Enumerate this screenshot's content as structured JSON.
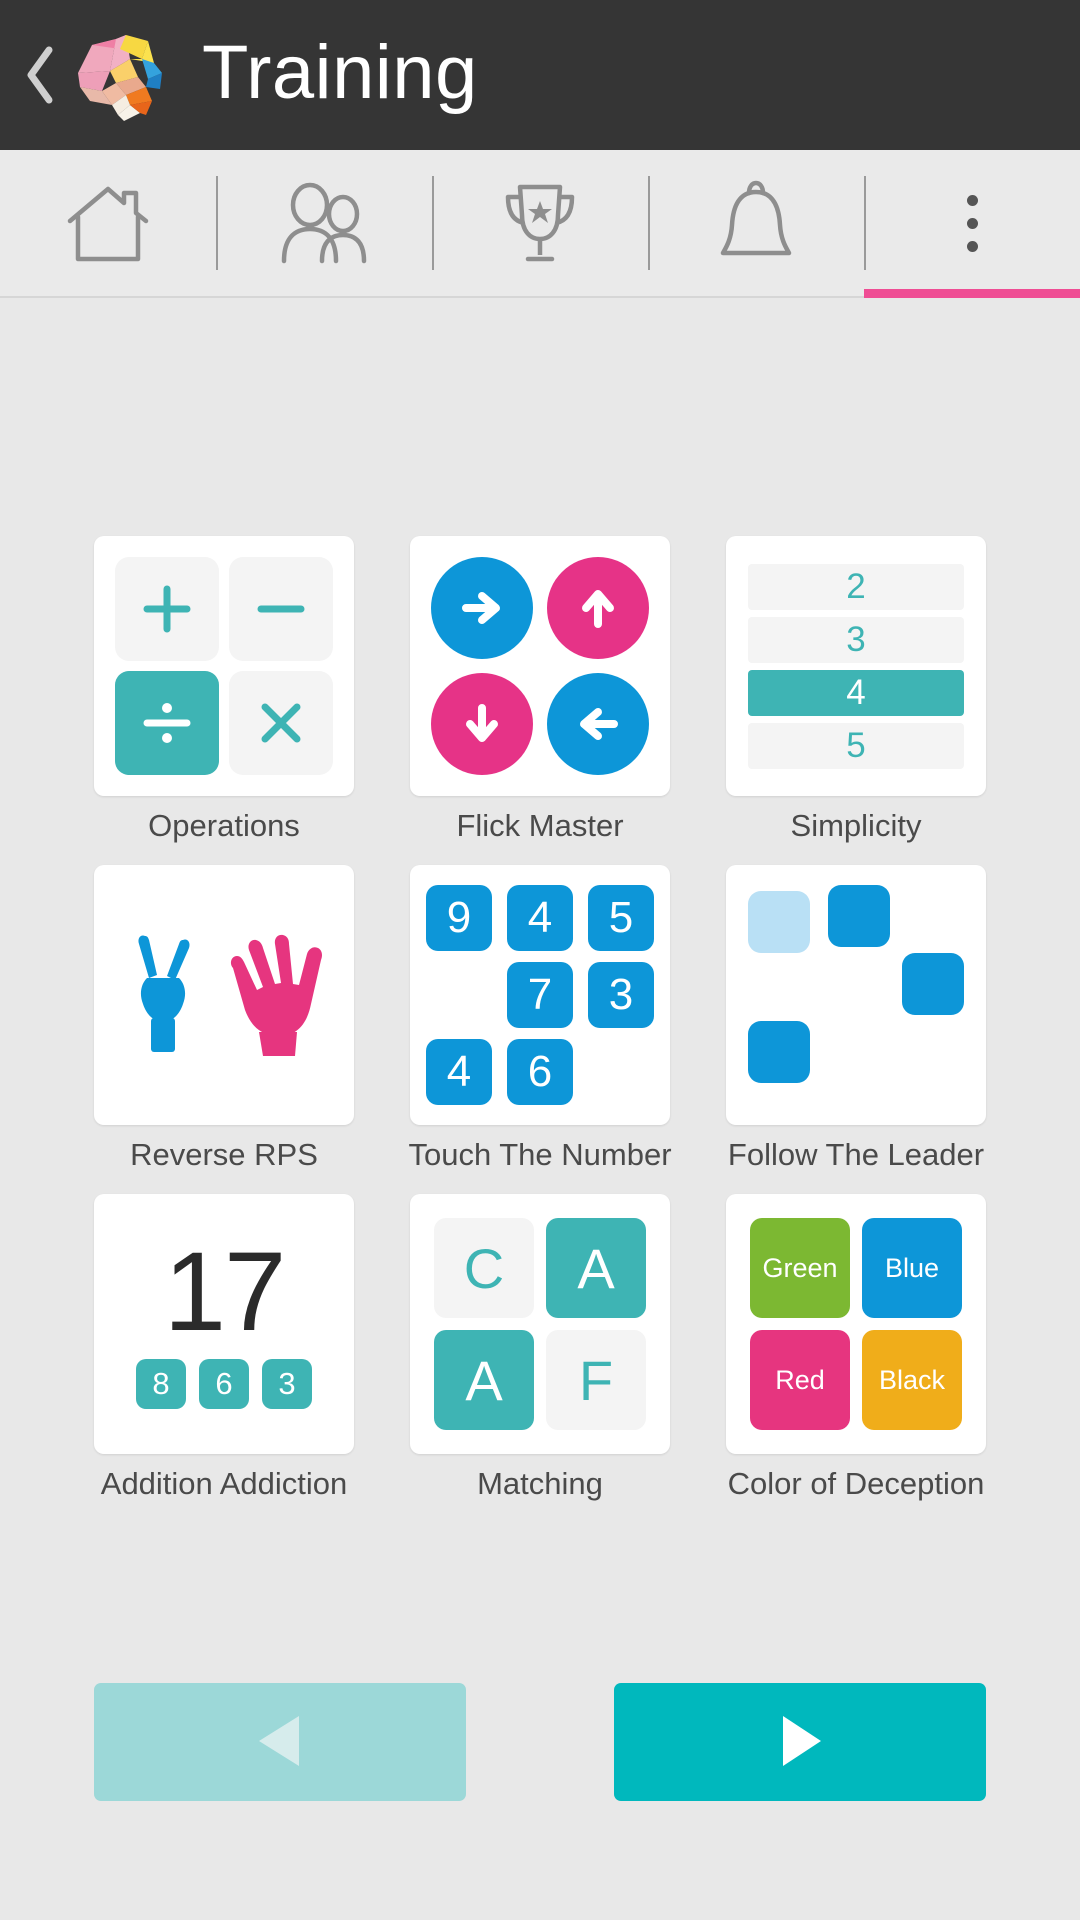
{
  "header": {
    "back_icon": "back-chevron-icon",
    "logo_icon": "brain-logo-icon",
    "title": "Training"
  },
  "tabbar": {
    "tabs": [
      {
        "icon": "home-icon",
        "name": "home"
      },
      {
        "icon": "people-icon",
        "name": "friends"
      },
      {
        "icon": "trophy-icon",
        "name": "achievements"
      },
      {
        "icon": "bell-icon",
        "name": "notifications"
      },
      {
        "icon": "overflow-menu-icon",
        "name": "more"
      }
    ],
    "active_index": 4,
    "indicator_color": "#ef4d94"
  },
  "games": [
    {
      "label": "Operations",
      "icon": "operations-icon",
      "symbols": [
        "+",
        "−",
        "÷",
        "×"
      ],
      "filled_index": 2,
      "accent": "#3eb4b4"
    },
    {
      "label": "Flick Master",
      "icon": "flick-master-icon",
      "arrows": [
        "right",
        "up",
        "down",
        "left"
      ],
      "arrow_colors": [
        "#0d96d8",
        "#e63387",
        "#e63387",
        "#0d96d8"
      ]
    },
    {
      "label": "Simplicity",
      "icon": "simplicity-icon",
      "rows": [
        "2",
        "3",
        "4",
        "5"
      ],
      "active_row": 2,
      "accent": "#3eb4b4"
    },
    {
      "label": "Reverse RPS",
      "icon": "reverse-rps-icon",
      "hands": [
        "scissors",
        "paper"
      ],
      "hand_colors": [
        "#0d96d8",
        "#e63387"
      ]
    },
    {
      "label": "Touch The Number",
      "icon": "touch-the-number-icon",
      "numbers": [
        "9",
        "4",
        "5",
        "7",
        "3",
        "4",
        "6"
      ],
      "accent": "#0d96d8"
    },
    {
      "label": "Follow The Leader",
      "icon": "follow-the-leader-icon",
      "squares": 4,
      "accent": "#0d96d8",
      "pale": "#b9e0f5"
    },
    {
      "label": "Addition Addiction",
      "icon": "addition-addiction-icon",
      "total": "17",
      "badges": [
        "8",
        "6",
        "3"
      ],
      "accent": "#3eb4b4"
    },
    {
      "label": "Matching",
      "icon": "matching-icon",
      "letters": [
        "C",
        "A",
        "A",
        "F"
      ],
      "filled": [
        false,
        true,
        true,
        false
      ],
      "accent": "#3eb4b4"
    },
    {
      "label": "Color of Deception",
      "icon": "color-of-deception-icon",
      "swatches": [
        {
          "text": "Green",
          "color": "#7cb832"
        },
        {
          "text": "Blue",
          "color": "#0d96d8"
        },
        {
          "text": "Red",
          "color": "#e6357f"
        },
        {
          "text": "Black",
          "color": "#f0ad1a"
        }
      ]
    }
  ],
  "pager": {
    "prev": {
      "icon": "triangle-left-icon",
      "name": "previous-page",
      "enabled": false,
      "color": "#9cd8d8"
    },
    "next": {
      "icon": "triangle-right-icon",
      "name": "next-page",
      "enabled": true,
      "color": "#00b8bd"
    }
  }
}
